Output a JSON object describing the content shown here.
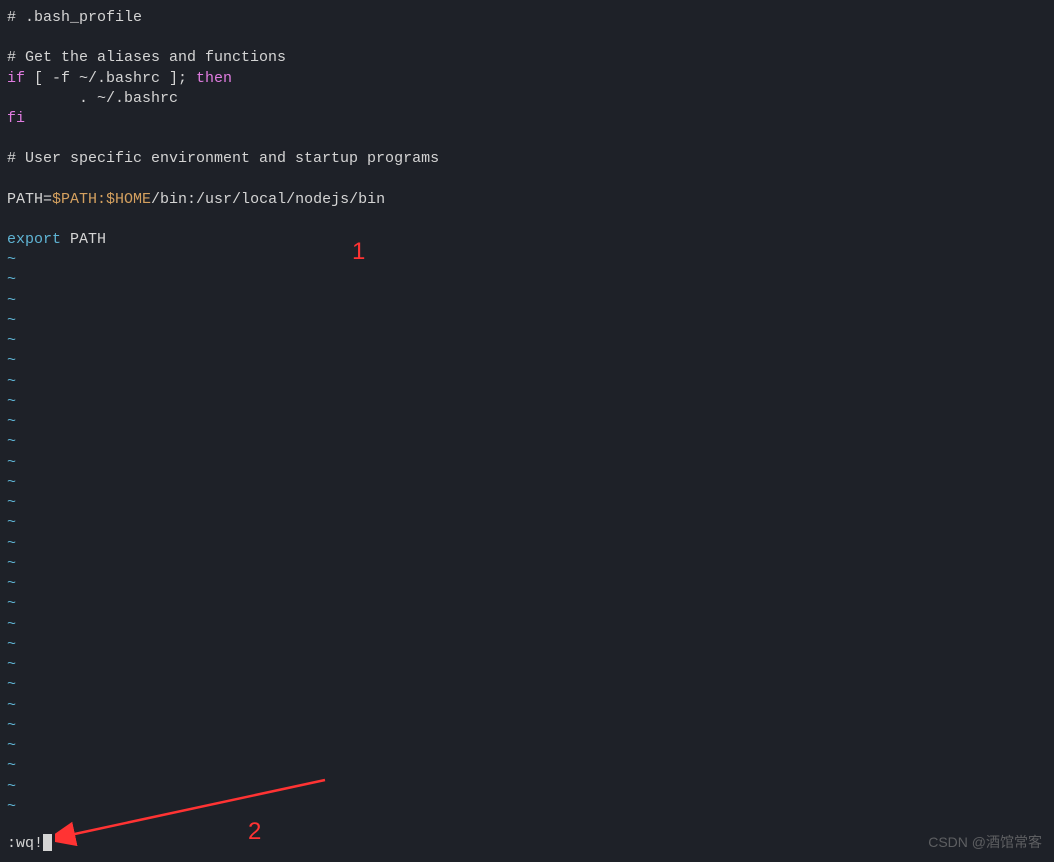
{
  "file": {
    "comment1": "# .bash_profile",
    "blank1": "",
    "comment2": "# Get the aliases and functions",
    "if_line": {
      "if": "if",
      "condition": " [ -f ~/.bashrc ]; ",
      "then": "then"
    },
    "source_line": "        . ~/.bashrc",
    "fi": "fi",
    "blank2": "",
    "comment3": "# User specific environment and startup programs",
    "blank3": "",
    "path_line": {
      "prefix": "PATH=",
      "vars": "$PATH:$HOME",
      "suffix": "/bin:/usr/local/nodejs/bin"
    },
    "blank4": "",
    "export_line": {
      "export": "export",
      "var": " PATH"
    }
  },
  "tildes": [
    "~",
    "~",
    "~",
    "~",
    "~",
    "~",
    "~",
    "~",
    "~",
    "~",
    "~",
    "~",
    "~",
    "~",
    "~",
    "~",
    "~",
    "~",
    "~",
    "~",
    "~",
    "~",
    "~",
    "~",
    "~",
    "~",
    "~",
    "~"
  ],
  "command": ":wq!",
  "annotations": {
    "label1": "1",
    "label2": "2"
  },
  "watermark": "CSDN @酒馆常客"
}
